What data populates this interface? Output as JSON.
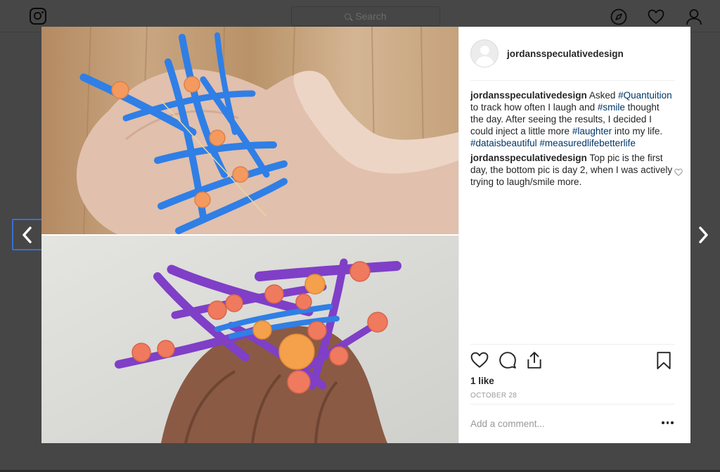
{
  "nav": {
    "search_placeholder": "Search",
    "icons": [
      "instagram-logo-icon",
      "search-icon",
      "compass-icon",
      "heart-icon",
      "profile-icon"
    ]
  },
  "post": {
    "username": "jordansspeculativedesign",
    "comments": [
      {
        "author": "jordansspeculativedesign",
        "parts": [
          {
            "text": "Asked ",
            "tag": false
          },
          {
            "text": "#Quantuition",
            "tag": true
          },
          {
            "text": " to track how often I laugh and ",
            "tag": false
          },
          {
            "text": "#smile",
            "tag": true
          },
          {
            "text": " thought the day. After seeing the results, I decided I could inject a little more ",
            "tag": false
          },
          {
            "text": "#laughter",
            "tag": true
          },
          {
            "text": " into my life. ",
            "tag": false
          },
          {
            "text": "#dataisbeautiful",
            "tag": true
          },
          {
            "text": " ",
            "tag": false
          },
          {
            "text": "#measuredlifebetterlife",
            "tag": true
          }
        ]
      },
      {
        "author": "jordansspeculativedesign",
        "parts": [
          {
            "text": "Top pic is the first day, the bottom pic is day 2, when I was actively trying to laugh/smile more.",
            "tag": false
          }
        ]
      }
    ],
    "likes": "1 like",
    "date": "OCTOBER 28",
    "comment_placeholder": "Add a comment...",
    "colors": {
      "hashtag": "#003569",
      "overlay": "#464646",
      "highlight_border": "#3a6fd0"
    }
  }
}
